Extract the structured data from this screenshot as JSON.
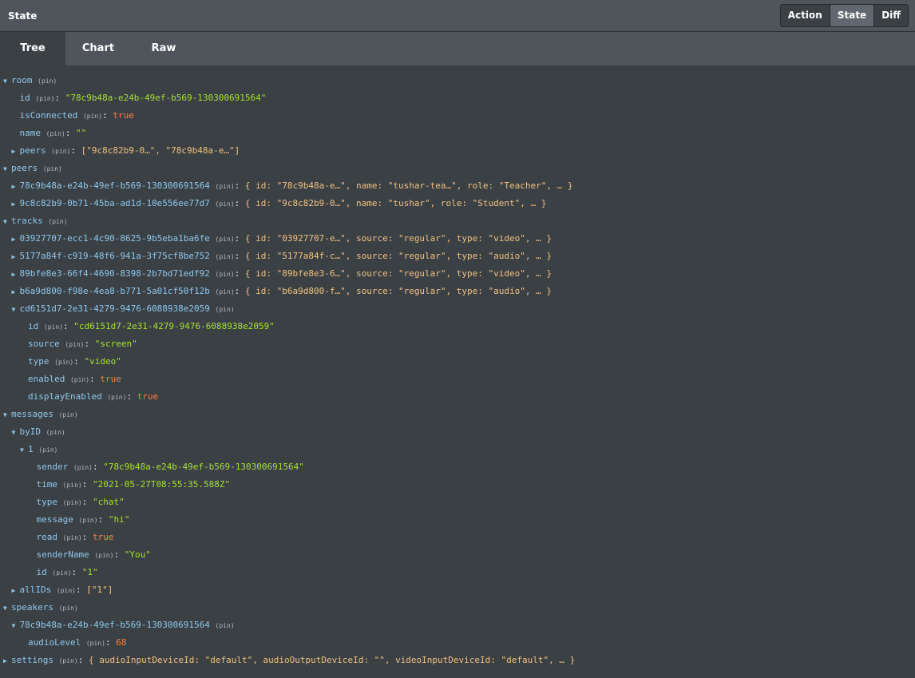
{
  "header": {
    "title": "State",
    "buttons": [
      "Action",
      "State",
      "Diff"
    ],
    "active_button": "State"
  },
  "tabs": [
    "Tree",
    "Chart",
    "Raw"
  ],
  "active_tab": "Tree",
  "pin_label": "(pin)",
  "colors": {
    "key": "#8fc8ec",
    "string": "#a6e22e",
    "boolean_number": "#fd7e3d",
    "preview": "#f0c27f",
    "background": "#3b4045",
    "toolbar": "#4f555b"
  },
  "tree": [
    {
      "depth": 0,
      "arrow": "down",
      "key": "room"
    },
    {
      "depth": 1,
      "arrow": "none",
      "key": "id",
      "value": "\"78c9b48a-e24b-49ef-b569-130300691564\"",
      "vtype": "str"
    },
    {
      "depth": 1,
      "arrow": "none",
      "key": "isConnected",
      "value": "true",
      "vtype": "bool"
    },
    {
      "depth": 1,
      "arrow": "none",
      "key": "name",
      "value": "\"\"",
      "vtype": "str"
    },
    {
      "depth": 1,
      "arrow": "right",
      "key": "peers",
      "value": "[\"9c8c82b9-0…\", \"78c9b48a-e…\"]",
      "vtype": "preview"
    },
    {
      "depth": 0,
      "arrow": "down",
      "key": "peers"
    },
    {
      "depth": 1,
      "arrow": "right",
      "key": "78c9b48a-e24b-49ef-b569-130300691564",
      "value": "{ id: \"78c9b48a-e…\", name: \"tushar-tea…\", role: \"Teacher\", … }",
      "vtype": "preview"
    },
    {
      "depth": 1,
      "arrow": "right",
      "key": "9c8c82b9-0b71-45ba-ad1d-10e556ee77d7",
      "value": "{ id: \"9c8c82b9-0…\", name: \"tushar\", role: \"Student\", … }",
      "vtype": "preview"
    },
    {
      "depth": 0,
      "arrow": "down",
      "key": "tracks"
    },
    {
      "depth": 1,
      "arrow": "right",
      "key": "03927707-ecc1-4c90-8625-9b5eba1ba6fe",
      "value": "{ id: \"03927707-e…\", source: \"regular\", type: \"video\", … }",
      "vtype": "preview"
    },
    {
      "depth": 1,
      "arrow": "right",
      "key": "5177a84f-c919-48f6-941a-3f75cf8be752",
      "value": "{ id: \"5177a84f-c…\", source: \"regular\", type: \"audio\", … }",
      "vtype": "preview"
    },
    {
      "depth": 1,
      "arrow": "right",
      "key": "89bfe8e3-66f4-4690-8398-2b7bd71edf92",
      "value": "{ id: \"89bfe8e3-6…\", source: \"regular\", type: \"video\", … }",
      "vtype": "preview"
    },
    {
      "depth": 1,
      "arrow": "right",
      "key": "b6a9d800-f98e-4ea8-b771-5a01cf50f12b",
      "value": "{ id: \"b6a9d800-f…\", source: \"regular\", type: \"audio\", … }",
      "vtype": "preview"
    },
    {
      "depth": 1,
      "arrow": "down",
      "key": "cd6151d7-2e31-4279-9476-6088938e2059"
    },
    {
      "depth": 2,
      "arrow": "none",
      "key": "id",
      "value": "\"cd6151d7-2e31-4279-9476-6088938e2059\"",
      "vtype": "str"
    },
    {
      "depth": 2,
      "arrow": "none",
      "key": "source",
      "value": "\"screen\"",
      "vtype": "str"
    },
    {
      "depth": 2,
      "arrow": "none",
      "key": "type",
      "value": "\"video\"",
      "vtype": "str"
    },
    {
      "depth": 2,
      "arrow": "none",
      "key": "enabled",
      "value": "true",
      "vtype": "bool"
    },
    {
      "depth": 2,
      "arrow": "none",
      "key": "displayEnabled",
      "value": "true",
      "vtype": "bool"
    },
    {
      "depth": 0,
      "arrow": "down",
      "key": "messages"
    },
    {
      "depth": 1,
      "arrow": "down",
      "key": "byID"
    },
    {
      "depth": 2,
      "arrow": "down",
      "key": "1"
    },
    {
      "depth": 3,
      "arrow": "none",
      "key": "sender",
      "value": "\"78c9b48a-e24b-49ef-b569-130300691564\"",
      "vtype": "str"
    },
    {
      "depth": 3,
      "arrow": "none",
      "key": "time",
      "value": "\"2021-05-27T08:55:35.588Z\"",
      "vtype": "str"
    },
    {
      "depth": 3,
      "arrow": "none",
      "key": "type",
      "value": "\"chat\"",
      "vtype": "str"
    },
    {
      "depth": 3,
      "arrow": "none",
      "key": "message",
      "value": "\"hi\"",
      "vtype": "str"
    },
    {
      "depth": 3,
      "arrow": "none",
      "key": "read",
      "value": "true",
      "vtype": "bool"
    },
    {
      "depth": 3,
      "arrow": "none",
      "key": "senderName",
      "value": "\"You\"",
      "vtype": "str"
    },
    {
      "depth": 3,
      "arrow": "none",
      "key": "id",
      "value": "\"1\"",
      "vtype": "str"
    },
    {
      "depth": 1,
      "arrow": "right",
      "key": "allIDs",
      "value": "[\"1\"]",
      "vtype": "preview"
    },
    {
      "depth": 0,
      "arrow": "down",
      "key": "speakers"
    },
    {
      "depth": 1,
      "arrow": "down",
      "key": "78c9b48a-e24b-49ef-b569-130300691564"
    },
    {
      "depth": 2,
      "arrow": "none",
      "key": "audioLevel",
      "value": "68",
      "vtype": "num"
    },
    {
      "depth": 0,
      "arrow": "right",
      "key": "settings",
      "value": "{ audioInputDeviceId: \"default\", audioOutputDeviceId: \"\", videoInputDeviceId: \"default\", … }",
      "vtype": "preview"
    }
  ]
}
